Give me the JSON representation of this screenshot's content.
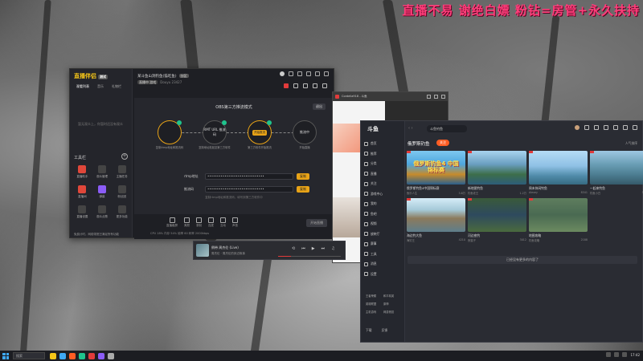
{
  "banner": "直播不易  谢绝白嫖   粉钻=房管+永久扶持",
  "assistant": {
    "logo": "直播伴侣",
    "version": "测试",
    "tabs": [
      "观看列表",
      "音乐",
      "礼物栏"
    ],
    "empty_hint": "暂无观众上，你暂时还没有观众",
    "tools_title": "工具栏",
    "tools": [
      {
        "label": "直播助手",
        "style": "red"
      },
      {
        "label": "观众管理",
        "style": ""
      },
      {
        "label": "主播任务",
        "style": ""
      },
      {
        "label": "直播间",
        "style": "red"
      },
      {
        "label": "弹幕",
        "style": "purple"
      },
      {
        "label": "粉丝团",
        "style": ""
      },
      {
        "label": "直播设置",
        "style": ""
      },
      {
        "label": "观众点歌",
        "style": ""
      },
      {
        "label": "更多功能",
        "style": ""
      }
    ],
    "status": "免费计时，网络带宽已满足所有功能",
    "room_title": "某斗鱼山洞钓鱼(猫吃鱼)",
    "room_tag": "分区",
    "room_sub_pill": "直播中 游戏",
    "room_sub": "Douyu  23427",
    "mode_title": "OBS第三方推流模式",
    "exit_label": "退出",
    "steps": [
      {
        "center": "",
        "label": "复制rtmp地址和推流码",
        "gold": true
      },
      {
        "center": "RMT URL 推流码",
        "label": "复制地址粘贴至第三方软件",
        "gold": false
      },
      {
        "center": "开始推流",
        "label": "第三方软件开始推流",
        "gold": true
      },
      {
        "center": "推流中",
        "label": "开始直播",
        "gold": false
      }
    ],
    "rtmp_label": "rtmp地址",
    "rtmp_value": "••••••••••••••••••••••••••••••",
    "key_label": "推流码",
    "key_value": "••••••••••••••••••••••••••••••",
    "copy_label": "复制",
    "hint": "复制rtmp地址和推流码，填写到第三方软件中",
    "bottom_tools": [
      "直播截屏",
      "美颜",
      "录制",
      "连麦",
      "互动",
      "声音"
    ],
    "go_live": "开始直播",
    "stats": "CPU 18%   内存 54%   帧率 60   码率 2000kbps"
  },
  "browser": {
    "tab_title": "Cordelia918 - 斗鱼"
  },
  "douyu": {
    "logo": "斗鱼",
    "search": "斗鱼钓鱼",
    "nav": [
      "首页",
      "推荐",
      "分类",
      "直播",
      "关注",
      "游戏中心",
      "我的",
      "鱼吧",
      "视频",
      "放映厅",
      "赛事",
      "工具",
      "消息",
      "设置"
    ],
    "games": [
      "王者荣耀",
      "和平精英",
      "英雄联盟",
      "原神",
      "主机游戏",
      "网游竞技"
    ],
    "bottom": [
      "下载",
      "反馈"
    ],
    "category": "俄罗斯钓鱼",
    "follow_label": "关注",
    "sort_label": "人气排序",
    "cards": [
      {
        "title": "俄罗斯钓鱼4中国锦标赛",
        "meta_left": "鱼乐人生",
        "meta_right": "3.6万",
        "overlay": "俄罗斯钓鱼4 中国锦标赛",
        "theme": "t1"
      },
      {
        "title": "新地图钓鱼",
        "meta_left": "钓鱼老王",
        "meta_right": "1.2万",
        "overlay": "",
        "theme": "t2"
      },
      {
        "title": "周末休闲钓鱼",
        "meta_left": "Alexey",
        "meta_right": "8341",
        "overlay": "",
        "theme": "t3"
      },
      {
        "title": "一起来钓鱼",
        "meta_left": "钓鱼小白",
        "meta_right": "5620",
        "overlay": "",
        "theme": "t4"
      },
      {
        "title": "海边钓大鱼",
        "meta_left": "海钓王",
        "meta_right": "4210",
        "overlay": "",
        "theme": "t5"
      },
      {
        "title": "河边夜钓",
        "meta_left": "夜猫子",
        "meta_right": "3012",
        "overlay": "",
        "theme": "t6"
      },
      {
        "title": "地图攻略",
        "meta_left": "钓鱼攻略",
        "meta_right": "2188",
        "overlay": "",
        "theme": "t7"
      }
    ],
    "no_more": "已经没有更多的内容了"
  },
  "player": {
    "song": "倒带 周杰伦 (Live)",
    "artist": "周杰伦 · 周杰伦的床边故事",
    "controls": [
      "⟲",
      "⏮",
      "▶",
      "⏭",
      "♫"
    ],
    "progress": 0.2
  },
  "taskbar": {
    "search_placeholder": "搜索",
    "time": "17:42",
    "app_colors": [
      "#f5c518",
      "#3fa9f5",
      "#ff5d23",
      "#1fc38d",
      "#e23b3b",
      "#8b5cf6",
      "#aaaaaa"
    ]
  }
}
